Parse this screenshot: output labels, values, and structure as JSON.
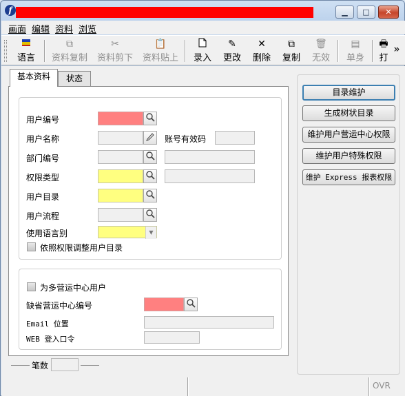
{
  "window": {
    "title_redaction_color": "#ff0000"
  },
  "menu": {
    "items": [
      "画面",
      "编辑",
      "资料",
      "浏览"
    ]
  },
  "toolbar": {
    "buttons": [
      {
        "label": "语言",
        "icon": "flag-icon",
        "enabled": true
      },
      {
        "label": "资料复制",
        "icon": "copy-icon",
        "enabled": false
      },
      {
        "label": "资料剪下",
        "icon": "scissors-icon",
        "enabled": false
      },
      {
        "label": "资料贴上",
        "icon": "paste-icon",
        "enabled": false
      },
      {
        "label": "录入",
        "icon": "new-document-icon",
        "enabled": true
      },
      {
        "label": "更改",
        "icon": "pencil-icon",
        "enabled": true
      },
      {
        "label": "删除",
        "icon": "delete-x-icon",
        "enabled": true
      },
      {
        "label": "复制",
        "icon": "duplicate-icon",
        "enabled": true
      },
      {
        "label": "无效",
        "icon": "trash-icon",
        "enabled": false
      },
      {
        "label": "单身",
        "icon": "detail-icon",
        "enabled": false
      },
      {
        "label": "打",
        "icon": "print-icon",
        "enabled": true
      }
    ],
    "overflow": "»"
  },
  "tabs": [
    {
      "label": "基本资料",
      "active": true
    },
    {
      "label": "状态",
      "active": false
    }
  ],
  "form": {
    "user_id": {
      "label": "用户编号",
      "value": ""
    },
    "user_name": {
      "label": "用户名称",
      "value": ""
    },
    "account_valid": {
      "label": "账号有效码",
      "value": ""
    },
    "department": {
      "label": "部门编号",
      "value": "",
      "desc": ""
    },
    "permission_type": {
      "label": "权限类型",
      "value": "",
      "desc": ""
    },
    "user_directory": {
      "label": "用户目录",
      "value": ""
    },
    "user_flow": {
      "label": "用户流程",
      "value": ""
    },
    "language": {
      "label": "使用语言别",
      "value": ""
    },
    "adjust_by_permission": {
      "label": "依照权限调整用户目录",
      "checked": false
    },
    "multi_center_user": {
      "label": "为多营运中心用户",
      "checked": false
    },
    "default_center": {
      "label": "缺省营运中心编号",
      "value": ""
    },
    "email": {
      "label": "Email 位置",
      "value": ""
    },
    "web_password": {
      "label": "WEB 登入口令",
      "value": ""
    }
  },
  "actions": [
    "目录维护",
    "生成树状目录",
    "维护用户营运中心权限",
    "维护用户特殊权限",
    "维护 Express 报表权限"
  ],
  "status": {
    "count_label": "笔数",
    "count_value": "",
    "mode": "OVR"
  },
  "colors": {
    "required_field": "#ff8080",
    "highlight_field": "#ffff80",
    "window_frame": "#bcd2ec"
  }
}
